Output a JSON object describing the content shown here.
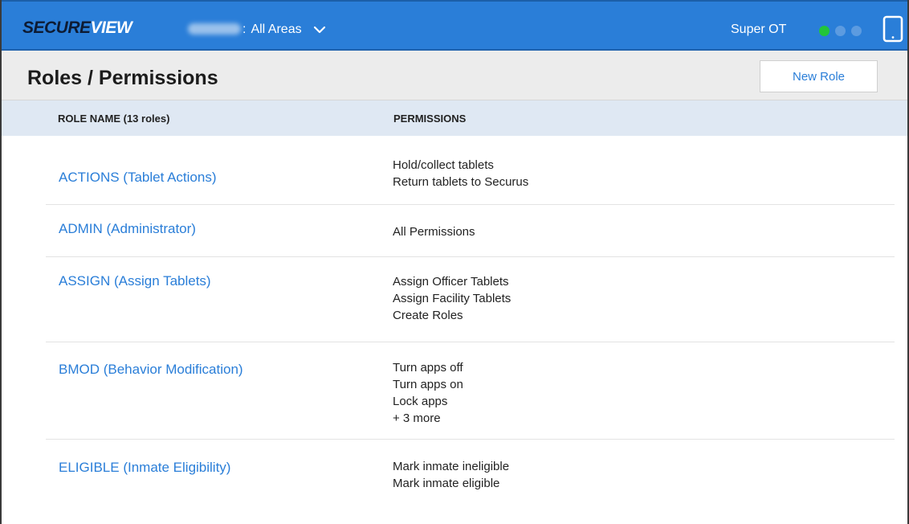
{
  "topbar": {
    "logo_part1": "SECURE",
    "logo_part2": "VIEW",
    "area_separator": ":",
    "area_label": "All Areas",
    "user_name": "Super OT",
    "status_dots": [
      "#22c53a",
      "#5c9be0",
      "#5c9be0"
    ],
    "icons": [
      "chevron-down-icon",
      "tablet-icon"
    ]
  },
  "header": {
    "title": "Roles / Permissions",
    "new_role_label": "New Role"
  },
  "table": {
    "col_role": "ROLE NAME (13 roles)",
    "col_permissions": "PERMISSIONS",
    "rows": [
      {
        "role": "ACTIONS (Tablet Actions)",
        "permissions": [
          "Hold/collect tablets",
          "Return tablets to Securus"
        ]
      },
      {
        "role": "ADMIN (Administrator)",
        "permissions": [
          "All Permissions"
        ]
      },
      {
        "role": "ASSIGN (Assign Tablets)",
        "permissions": [
          "Assign Officer Tablets",
          "Assign Facility Tablets",
          "Create Roles"
        ]
      },
      {
        "role": "BMOD (Behavior Modification)",
        "permissions": [
          "Turn apps off",
          "Turn apps on",
          "Lock apps",
          "+ 3 more"
        ]
      },
      {
        "role": "ELIGIBLE (Inmate Eligibility)",
        "permissions": [
          "Mark inmate ineligible",
          "Mark inmate eligible"
        ]
      }
    ]
  },
  "colors": {
    "accent": "#2a7ed8",
    "topbar": "#2a7ed8",
    "header_bg": "#ececec",
    "column_header_bg": "#dfe8f3"
  }
}
